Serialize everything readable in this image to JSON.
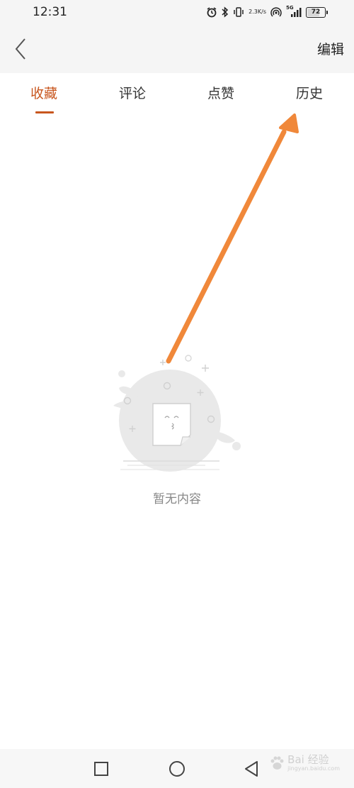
{
  "status_bar": {
    "time": "12:31",
    "net_speed_value": "2.3",
    "net_speed_unit": "K/s",
    "signal_label": "5G",
    "battery_level": "72",
    "battery_fraction": 0.72
  },
  "header": {
    "back_icon": "chevron-left-icon",
    "edit_label": "编辑"
  },
  "tabs": [
    {
      "label": "收藏",
      "active": true
    },
    {
      "label": "评论",
      "active": false
    },
    {
      "label": "点赞",
      "active": false
    },
    {
      "label": "历史",
      "active": false
    }
  ],
  "empty_state": {
    "icon": "empty-document-icon",
    "message": "暂无内容"
  },
  "annotation": {
    "type": "arrow",
    "color": "#f0883a",
    "points_to": "tab-history"
  },
  "nav_bar": {
    "recent_icon": "square-icon",
    "home_icon": "circle-icon",
    "back_icon": "triangle-back-icon"
  },
  "watermark": {
    "text": "Bai 经验",
    "subtext": "jingyan.baidu.com"
  },
  "colors": {
    "accent": "#c8561e",
    "arrow": "#f0883a",
    "header_bg": "#f5f5f5",
    "empty_gray": "#e9e9e9"
  }
}
